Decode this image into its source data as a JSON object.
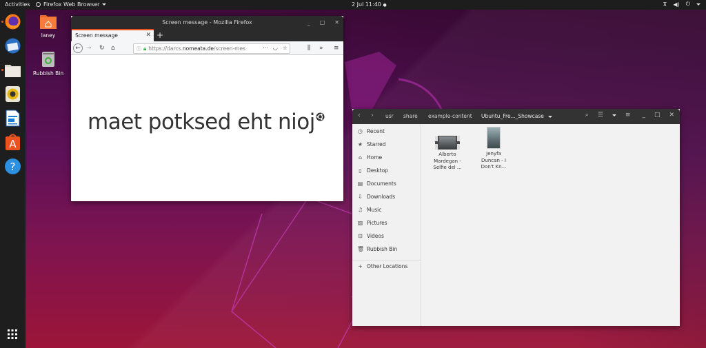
{
  "topbar": {
    "activities": "Activities",
    "app_name": "Firefox Web Browser",
    "clock": "2 Jul  11:40",
    "tray_icons": [
      "network-icon",
      "volume-icon",
      "power-icon"
    ]
  },
  "dock": {
    "items": [
      {
        "name": "firefox",
        "running": true
      },
      {
        "name": "thunderbird",
        "running": false
      },
      {
        "name": "files",
        "running": true
      },
      {
        "name": "rhythmbox",
        "running": false
      },
      {
        "name": "libreoffice-writer",
        "running": false
      },
      {
        "name": "ubuntu-software",
        "running": false
      },
      {
        "name": "help",
        "running": false
      }
    ],
    "show_apps": "show-applications-icon"
  },
  "desktop": {
    "icons": [
      {
        "label": "laney",
        "icon": "home-folder-icon"
      },
      {
        "label": "Rubbish Bin",
        "icon": "trash-icon"
      }
    ]
  },
  "firefox": {
    "window_title": "Screen message - Mozilla Firefox",
    "tab_title": "Screen message",
    "url_prefix": "https://darcs.",
    "url_host": "nomeata.de",
    "url_suffix": "/screen-mes",
    "page_text": "maet potksed eht nioj"
  },
  "files": {
    "breadcrumbs": [
      "usr",
      "share",
      "example-content",
      "Ubuntu_Fre..._Showcase"
    ],
    "sidebar": [
      {
        "label": "Recent",
        "icon": "clock-icon"
      },
      {
        "label": "Starred",
        "icon": "star-icon"
      },
      {
        "label": "Home",
        "icon": "home-icon"
      },
      {
        "label": "Desktop",
        "icon": "desktop-icon"
      },
      {
        "label": "Documents",
        "icon": "document-icon"
      },
      {
        "label": "Downloads",
        "icon": "download-icon"
      },
      {
        "label": "Music",
        "icon": "music-icon"
      },
      {
        "label": "Pictures",
        "icon": "picture-icon"
      },
      {
        "label": "Videos",
        "icon": "video-icon"
      },
      {
        "label": "Rubbish Bin",
        "icon": "trash-icon"
      }
    ],
    "other_locations": "Other Locations",
    "items": [
      {
        "line1": "Alberto",
        "line2": "Mardegan -",
        "line3": "Selfie del ...",
        "type": "video"
      },
      {
        "line1": "Jenyfa",
        "line2": "Duncan - I",
        "line3": "Don't Kn...",
        "type": "image"
      }
    ]
  },
  "colors": {
    "accent": "#e95420",
    "topbar": "#1d1d1d",
    "dock": "#1e1e1e",
    "headerbar": "#333333"
  }
}
